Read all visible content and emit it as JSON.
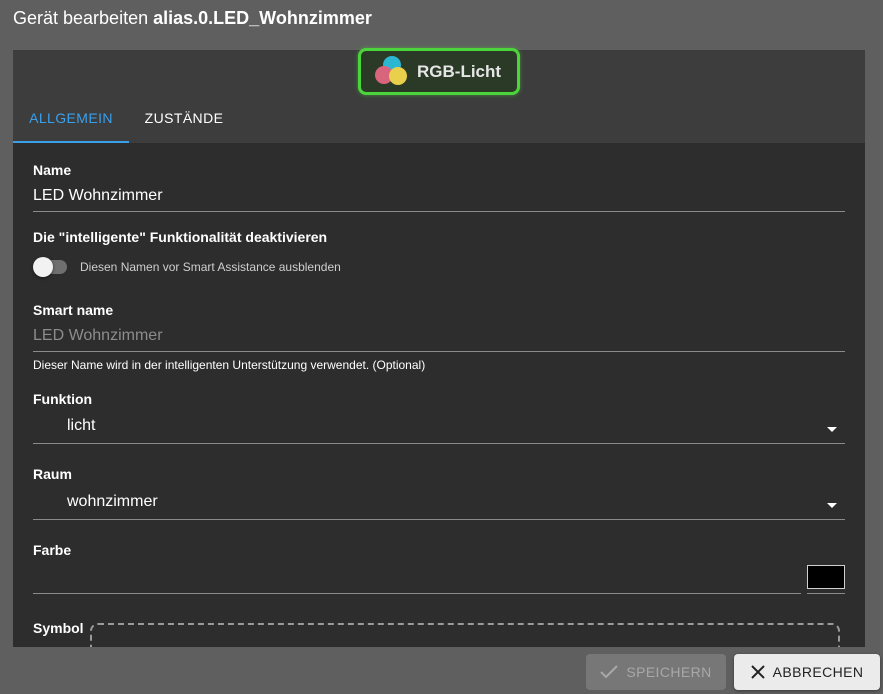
{
  "dialog": {
    "title_prefix": "Gerät bearbeiten",
    "title_id": "alias.0.LED_Wohnzimmer"
  },
  "device_type": {
    "label": "RGB-Licht",
    "icon": "rgb-circles-icon",
    "badge_border_color": "#4cd53a"
  },
  "tabs": [
    {
      "label": "ALLGEMEIN",
      "active": true
    },
    {
      "label": "ZUSTÄNDE",
      "active": false
    }
  ],
  "form": {
    "name": {
      "label": "Name",
      "value": "LED Wohnzimmer"
    },
    "smart_toggle": {
      "label": "Die \"intelligente\" Funktionalität deaktivieren",
      "toggle_text": "Diesen Namen vor Smart Assistance ausblenden",
      "checked": false
    },
    "smart_name": {
      "label": "Smart name",
      "placeholder": "LED Wohnzimmer",
      "helper": "Dieser Name wird in der intelligenten Unterstützung verwendet. (Optional)"
    },
    "function": {
      "label": "Funktion",
      "value": "licht"
    },
    "room": {
      "label": "Raum",
      "value": "wohnzimmer"
    },
    "color": {
      "label": "Farbe",
      "value": "",
      "swatch_color": "#000000"
    },
    "symbol": {
      "label": "Symbol"
    }
  },
  "buttons": {
    "save": {
      "label": "SPEICHERN",
      "icon": "check-icon",
      "disabled": true
    },
    "cancel": {
      "label": "ABBRECHEN",
      "icon": "close-icon"
    }
  },
  "colors": {
    "accent": "#3aa0ec",
    "background": "#5f5f5f",
    "panel": "#2d2d2d"
  }
}
